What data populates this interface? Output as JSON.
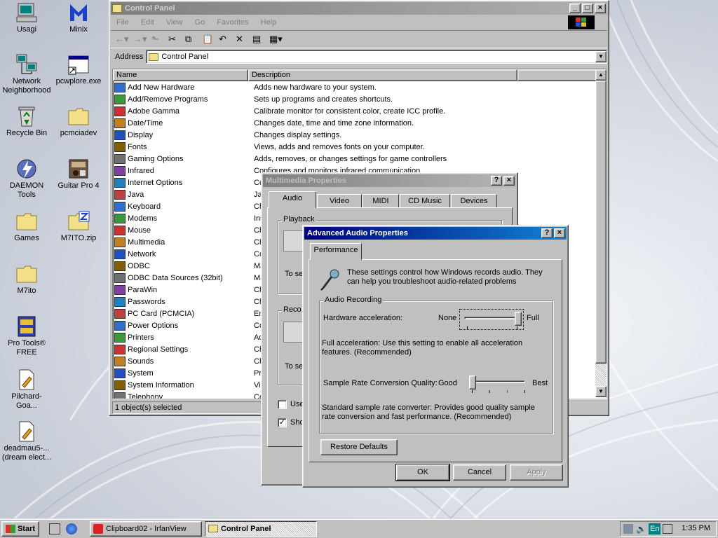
{
  "desktop": {
    "icons": [
      {
        "label": "Usagi"
      },
      {
        "label": "Minix"
      },
      {
        "label": "Network Neighborhood"
      },
      {
        "label": "pcwplore.exe"
      },
      {
        "label": "Recycle Bin"
      },
      {
        "label": "pcmciadev"
      },
      {
        "label": "DAEMON Tools"
      },
      {
        "label": "Guitar Pro 4"
      },
      {
        "label": "Games"
      },
      {
        "label": "M7ITO.zip"
      },
      {
        "label": "M7ito"
      },
      {
        "label": "Pro Tools® FREE"
      },
      {
        "label": "Pilchard-Goa..."
      },
      {
        "label": "deadmau5-...(dream elect..."
      }
    ]
  },
  "control_panel": {
    "title": "Control Panel",
    "menu": [
      "File",
      "Edit",
      "View",
      "Go",
      "Favorites",
      "Help"
    ],
    "address_label": "Address",
    "address_value": "Control Panel",
    "columns": {
      "name": "Name",
      "description": "Description"
    },
    "items": [
      {
        "name": "Add New Hardware",
        "desc": "Adds new hardware to your system."
      },
      {
        "name": "Add/Remove Programs",
        "desc": "Sets up programs and creates shortcuts."
      },
      {
        "name": "Adobe Gamma",
        "desc": "Calibrate monitor for consistent color, create ICC profile."
      },
      {
        "name": "Date/Time",
        "desc": "Changes date, time and time zone information."
      },
      {
        "name": "Display",
        "desc": "Changes display settings."
      },
      {
        "name": "Fonts",
        "desc": "Views, adds and removes fonts on your computer."
      },
      {
        "name": "Gaming Options",
        "desc": "Adds, removes, or changes settings for game controllers"
      },
      {
        "name": "Infrared",
        "desc": "Configures and monitors infrared communication"
      },
      {
        "name": "Internet Options",
        "desc": "Co"
      },
      {
        "name": "Java",
        "desc": "Jav"
      },
      {
        "name": "Keyboard",
        "desc": "Ch"
      },
      {
        "name": "Modems",
        "desc": "Ins"
      },
      {
        "name": "Mouse",
        "desc": "Ch"
      },
      {
        "name": "Multimedia",
        "desc": "Ch"
      },
      {
        "name": "Network",
        "desc": "Co"
      },
      {
        "name": "ODBC",
        "desc": "Ma"
      },
      {
        "name": "ODBC Data Sources (32bit)",
        "desc": "Ma"
      },
      {
        "name": "ParaWin",
        "desc": "Ch"
      },
      {
        "name": "Passwords",
        "desc": "Ch"
      },
      {
        "name": "PC Card (PCMCIA)",
        "desc": "En"
      },
      {
        "name": "Power Options",
        "desc": "Co"
      },
      {
        "name": "Printers",
        "desc": "Ad"
      },
      {
        "name": "Regional Settings",
        "desc": "Ch"
      },
      {
        "name": "Sounds",
        "desc": "Ch"
      },
      {
        "name": "System",
        "desc": "Pro"
      },
      {
        "name": "System Information",
        "desc": "Vie"
      },
      {
        "name": "Telephony",
        "desc": "Co"
      }
    ],
    "status": "1 object(s) selected"
  },
  "multimedia": {
    "title": "Multimedia Properties",
    "tabs": [
      "Audio",
      "Video",
      "MIDI",
      "CD Music",
      "Devices"
    ],
    "playback_label": "Playback",
    "recording_label": "Reco",
    "to_se_1": "To se",
    "to_se_2": "To se",
    "use_label": "Use",
    "show_label": "Sho"
  },
  "advanced": {
    "title": "Advanced Audio Properties",
    "tab": "Performance",
    "intro": "These settings control how Windows records audio. They can help you troubleshoot audio-related problems",
    "group_label": "Audio Recording",
    "hw_label": "Hardware acceleration:",
    "hw_min": "None",
    "hw_max": "Full",
    "hw_level": 1.0,
    "hw_desc": "Full acceleration: Use this setting to enable all acceleration features. (Recommended)",
    "src_label": "Sample Rate Conversion Quality:",
    "src_min": "Good",
    "src_max": "Best",
    "src_level": 0.0,
    "src_desc": "Standard sample rate converter:  Provides good quality sample rate conversion and fast performance. (Recommended)",
    "restore": "Restore Defaults",
    "ok": "OK",
    "cancel": "Cancel",
    "apply": "Apply"
  },
  "taskbar": {
    "start": "Start",
    "tasks": [
      "Clipboard02 - IrfanView",
      "Control Panel"
    ],
    "tray_lang": "En",
    "clock": "1:35 PM"
  }
}
